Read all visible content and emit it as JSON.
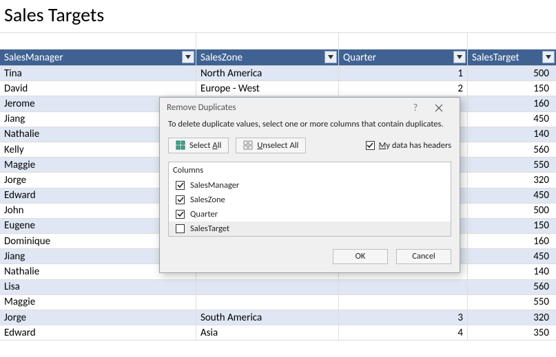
{
  "title": "Sales Targets",
  "headers": {
    "mgr": "SalesManager",
    "zone": "SalesZone",
    "qtr": "Quarter",
    "tgt": "SalesTarget"
  },
  "rows": [
    {
      "mgr": "Tina",
      "zone": "North America",
      "qtr": "1",
      "tgt": "500"
    },
    {
      "mgr": "David",
      "zone": "Europe - West",
      "qtr": "2",
      "tgt": "150"
    },
    {
      "mgr": "Jerome",
      "zone": "",
      "qtr": "",
      "tgt": "160"
    },
    {
      "mgr": "Jiang",
      "zone": "",
      "qtr": "",
      "tgt": "450"
    },
    {
      "mgr": "Nathalie",
      "zone": "",
      "qtr": "",
      "tgt": "140"
    },
    {
      "mgr": "Kelly",
      "zone": "",
      "qtr": "",
      "tgt": "560"
    },
    {
      "mgr": "Maggie",
      "zone": "",
      "qtr": "",
      "tgt": "550"
    },
    {
      "mgr": "Jorge",
      "zone": "",
      "qtr": "",
      "tgt": "320"
    },
    {
      "mgr": "Edward",
      "zone": "",
      "qtr": "",
      "tgt": "450"
    },
    {
      "mgr": "John",
      "zone": "",
      "qtr": "",
      "tgt": "500"
    },
    {
      "mgr": "Eugene",
      "zone": "",
      "qtr": "",
      "tgt": "150"
    },
    {
      "mgr": "Dominique",
      "zone": "",
      "qtr": "",
      "tgt": "160"
    },
    {
      "mgr": "Jiang",
      "zone": "",
      "qtr": "",
      "tgt": "450"
    },
    {
      "mgr": "Nathalie",
      "zone": "",
      "qtr": "",
      "tgt": "140"
    },
    {
      "mgr": "Lisa",
      "zone": "",
      "qtr": "",
      "tgt": "560"
    },
    {
      "mgr": "Maggie",
      "zone": "",
      "qtr": "",
      "tgt": "550"
    },
    {
      "mgr": "Jorge",
      "zone": "South America",
      "qtr": "3",
      "tgt": "320"
    },
    {
      "mgr": "Edward",
      "zone": "Asia",
      "qtr": "4",
      "tgt": "350"
    }
  ],
  "dialog": {
    "title": "Remove Duplicates",
    "help": "?",
    "message": "To delete duplicate values, select one or more columns that contain duplicates.",
    "select_all_pre": "Select ",
    "select_all_key": "A",
    "select_all_post": "ll",
    "unselect_all_pre": "",
    "unselect_all_key": "U",
    "unselect_all_post": "nselect All",
    "headers_pre": "",
    "headers_key": "M",
    "headers_post": "y data has headers",
    "columns_label": "Columns",
    "columns": [
      {
        "label": "SalesManager",
        "checked": true,
        "selected": false
      },
      {
        "label": "SalesZone",
        "checked": true,
        "selected": false
      },
      {
        "label": "Quarter",
        "checked": true,
        "selected": false
      },
      {
        "label": "SalesTarget",
        "checked": false,
        "selected": true
      }
    ],
    "ok": "OK",
    "cancel": "Cancel"
  }
}
